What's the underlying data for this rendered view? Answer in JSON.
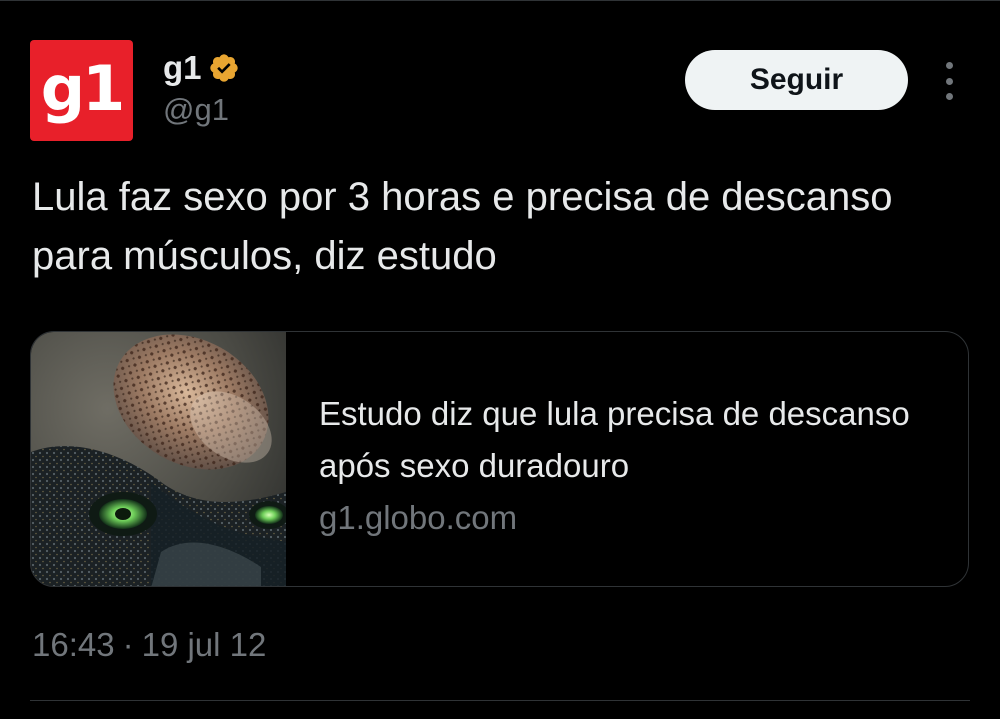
{
  "author": {
    "avatar_text": "g1",
    "display_name": "g1",
    "handle": "@g1",
    "verified_icon": "verified-badge-icon",
    "avatar_color": "#e8202a",
    "verified_color": "#e8a531"
  },
  "actions": {
    "follow_label": "Seguir",
    "more_icon": "more-options-icon"
  },
  "tweet": {
    "text": "Lula faz sexo por 3 horas e precisa de descanso para músculos, diz estudo"
  },
  "link_card": {
    "title": "Estudo diz que lula precisa de descanso após sexo duradouro",
    "domain": "g1.globo.com",
    "image": "squid-photo"
  },
  "meta": {
    "time": "16:43",
    "separator": "·",
    "date": "19 jul 12"
  },
  "colors": {
    "background": "#000000",
    "text_primary": "#e7e9ea",
    "text_secondary": "#71767b",
    "border": "#2f3336",
    "button_bg": "#eff3f4"
  }
}
